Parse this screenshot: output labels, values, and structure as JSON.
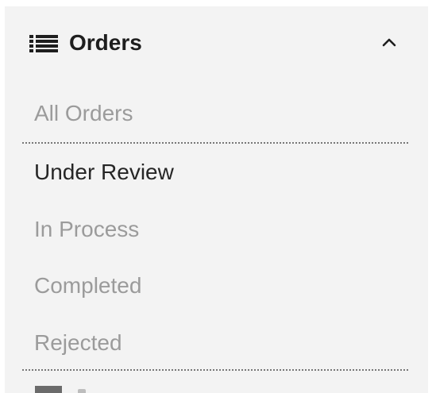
{
  "section": {
    "title": "Orders",
    "expanded": true
  },
  "nav": {
    "items": [
      {
        "label": "All Orders",
        "active": false
      },
      {
        "label": "Under Review",
        "active": true
      },
      {
        "label": "In Process",
        "active": false
      },
      {
        "label": "Completed",
        "active": false
      },
      {
        "label": "Rejected",
        "active": false
      }
    ]
  },
  "icons": {
    "section": "list-icon",
    "toggle": "chevron-up-icon",
    "next_section": "list-icon"
  },
  "colors": {
    "active_text": "#262626",
    "inactive_text": "#9b9b9b",
    "panel_background": "#f3f3f3"
  }
}
